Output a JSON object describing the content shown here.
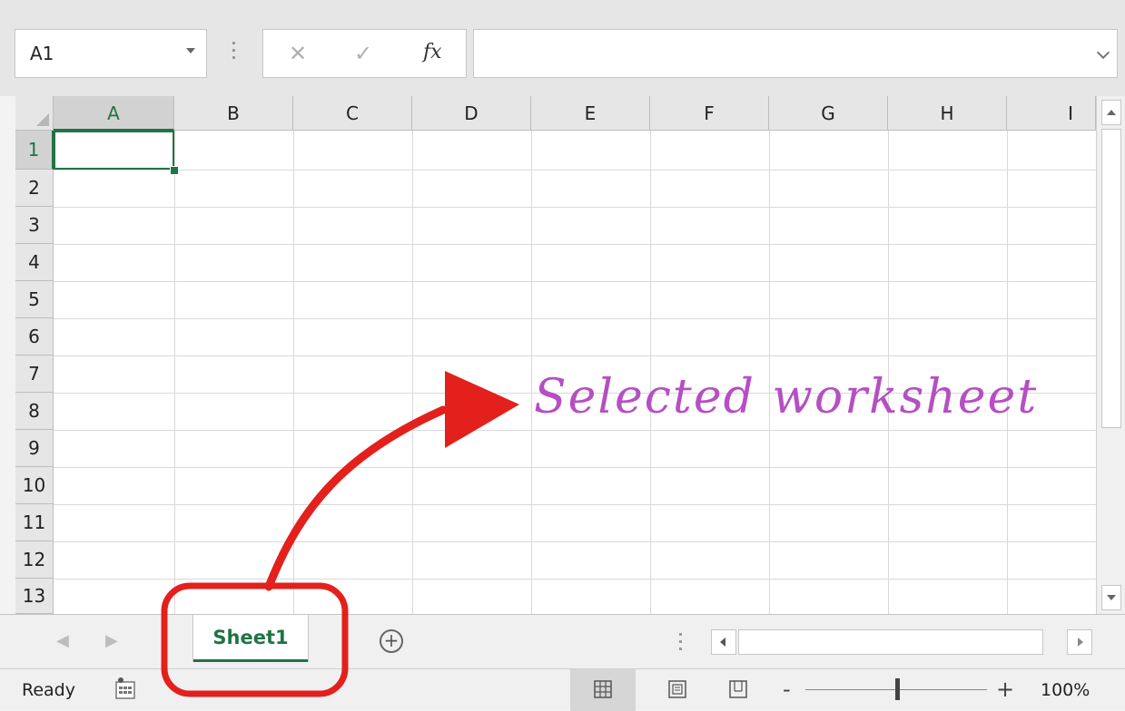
{
  "formula_bar": {
    "name_box_value": "A1",
    "cancel_glyph": "✕",
    "enter_glyph": "✓",
    "fx_label": "fx",
    "formula_value": ""
  },
  "grid": {
    "columns": [
      "A",
      "B",
      "C",
      "D",
      "E",
      "F",
      "G",
      "H",
      "I"
    ],
    "rows": [
      "1",
      "2",
      "3",
      "4",
      "5",
      "6",
      "7",
      "8",
      "9",
      "10",
      "11",
      "12",
      "13"
    ],
    "selected_cell": "A1"
  },
  "tabs": {
    "prev_glyph": "◀",
    "next_glyph": "▶",
    "sheet_name": "Sheet1",
    "add_glyph": "+"
  },
  "status": {
    "text": "Ready",
    "zoom_minus": "-",
    "zoom_plus": "+",
    "zoom_level": "100%"
  },
  "annotation": {
    "label": "Selected worksheet",
    "color": "#b54fc2",
    "arrow_color": "#e3201b"
  },
  "colors": {
    "excel_green": "#217346"
  }
}
